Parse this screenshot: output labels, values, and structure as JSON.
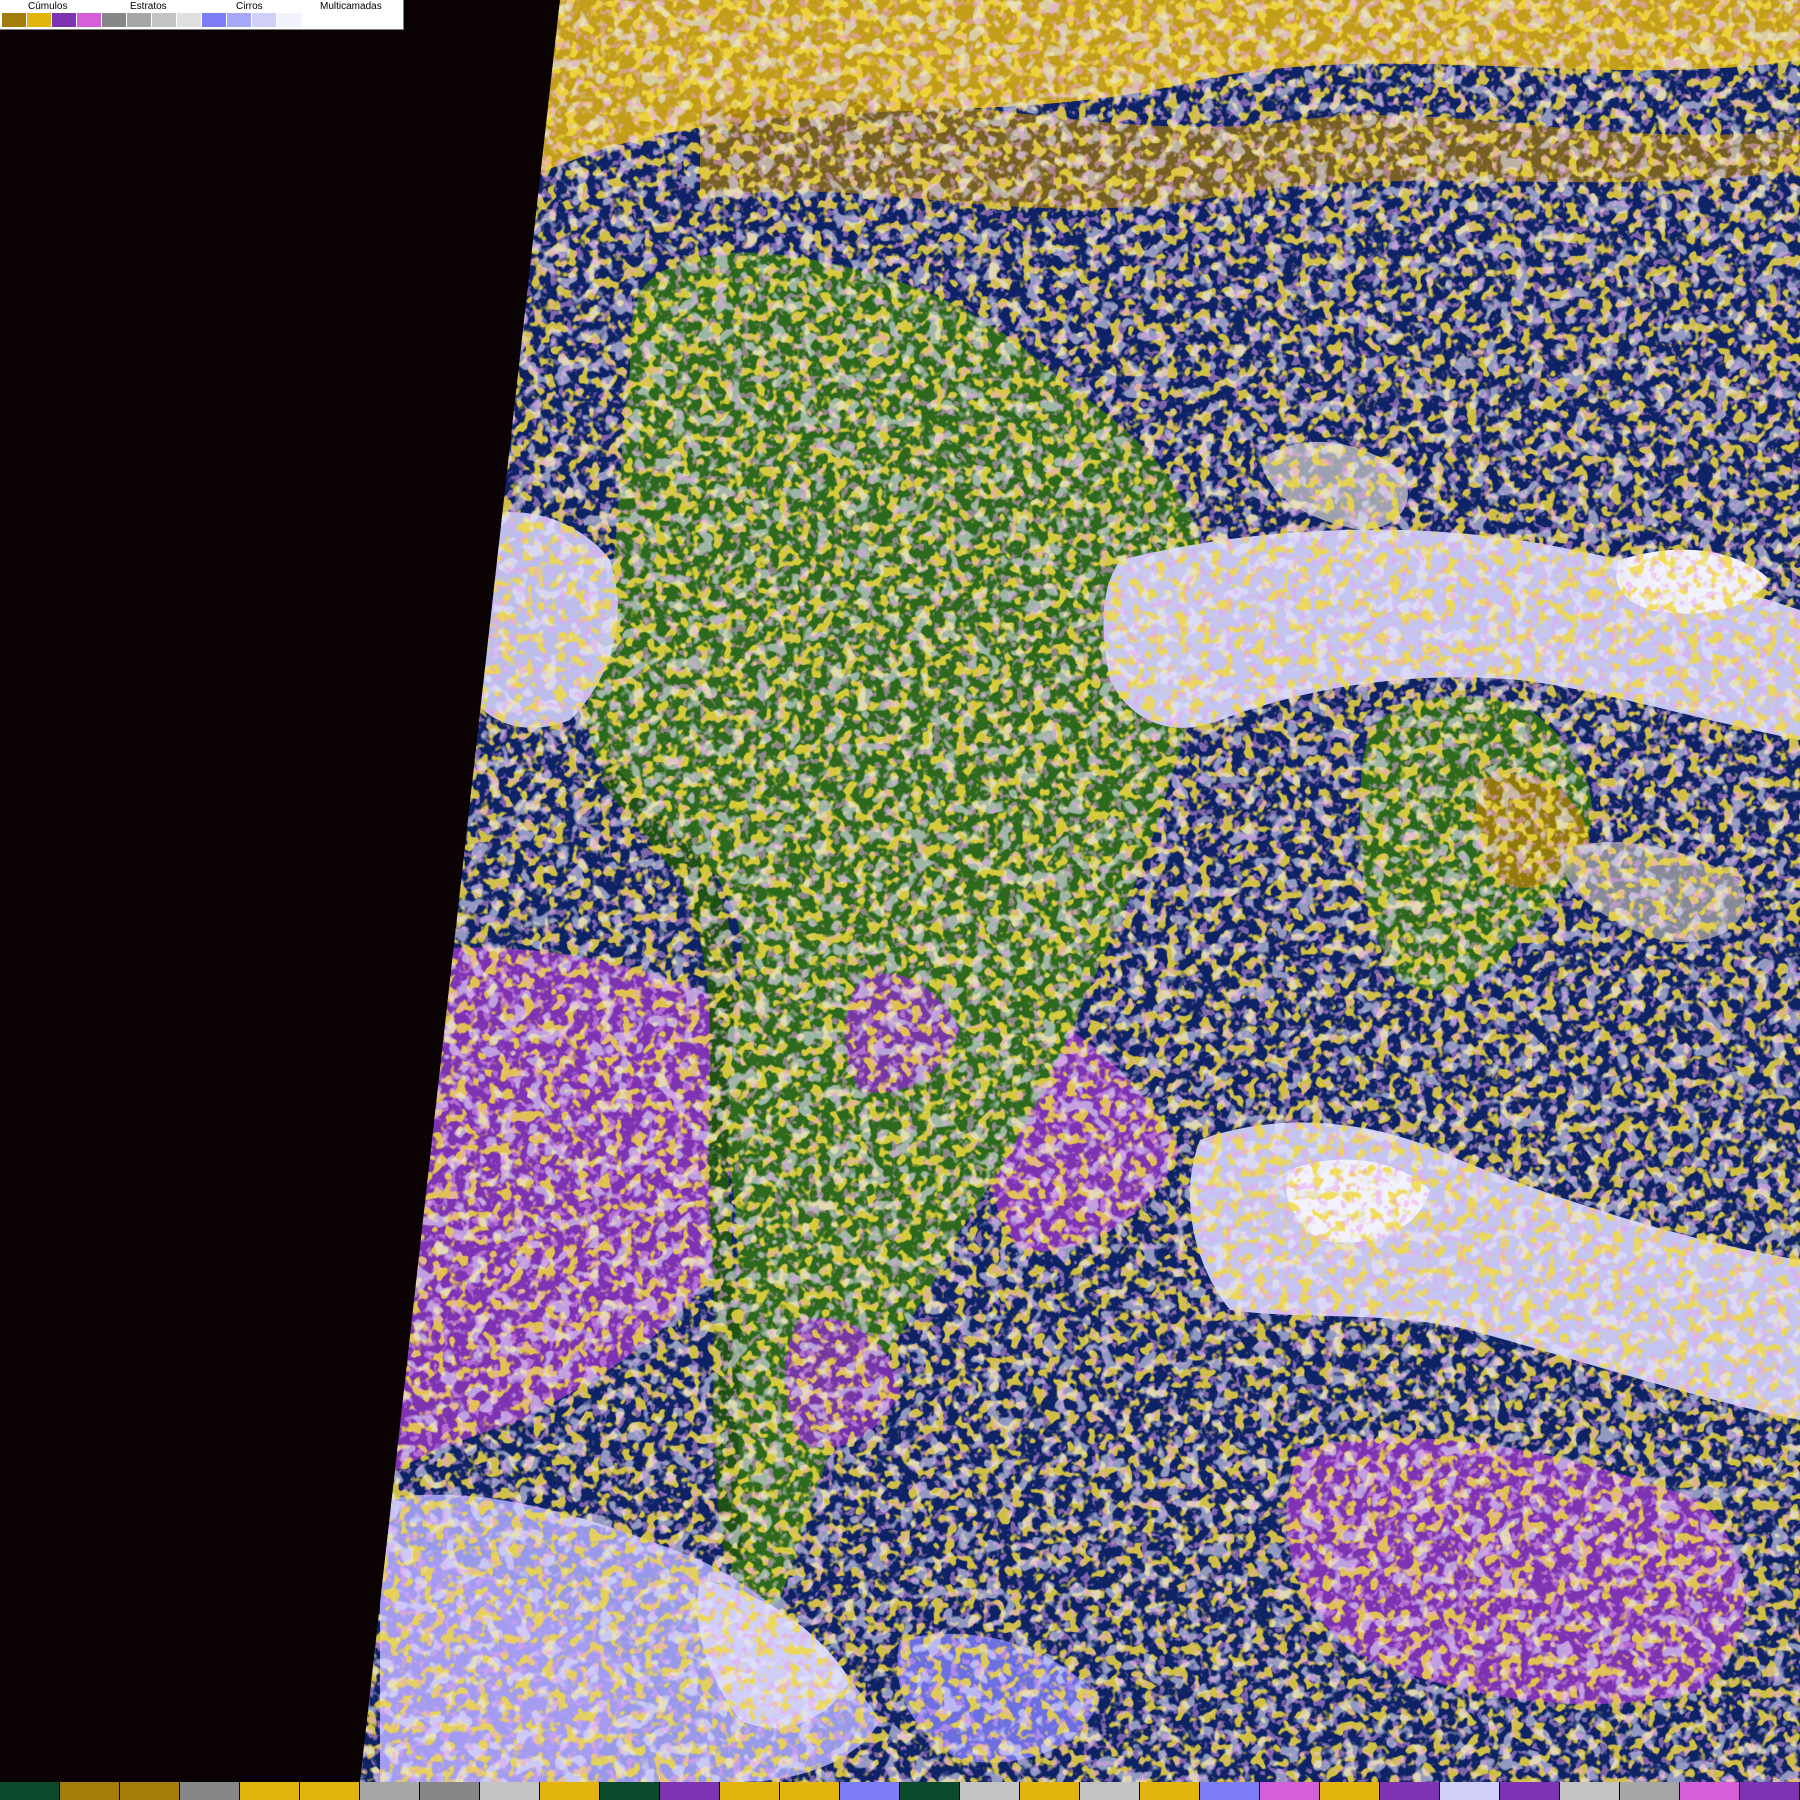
{
  "legend": {
    "categories": [
      {
        "label": "Cúmulos",
        "colors": [
          "#a47c0a",
          "#e3b40e"
        ]
      },
      {
        "label": "Estratos",
        "colors": [
          "#7e33b3",
          "#d65fd9"
        ]
      },
      {
        "label": "Cirros",
        "colors": [
          "#878787",
          "#a6a6a6",
          "#c3c3c3",
          "#e0e0e0"
        ]
      },
      {
        "label": "Multicamadas",
        "colors": [
          "#7c7cf5",
          "#a7a7f7",
          "#cfcff9",
          "#f2f2fd"
        ]
      }
    ]
  },
  "map": {
    "background_color": "#0a0203",
    "ocean_color": "#0e2266",
    "land_color": "#2e6a1e",
    "land_dark_color": "#1f5214",
    "stratus_color": "#7e33b3",
    "stratus_light_color": "#d65fd9",
    "cumulus_color": "#e3b40e",
    "cumulus_dark_color": "#a47c0a",
    "cirrus_color": "#c3c3c3",
    "multilayer_color": "#cfcff9",
    "multilayer_blue_color": "#7c7cf5",
    "multilayer_white_color": "#f2f2fd"
  },
  "bottom_strip": {
    "colors": [
      "#0b4a2a",
      "#a47c0a",
      "#a47c0a",
      "#878787",
      "#e3b40e",
      "#e3b40e",
      "#a6a6a6",
      "#878787",
      "#c3c3c3",
      "#e3b40e",
      "#0b4a2a",
      "#7e33b3",
      "#e3b40e",
      "#e3b40e",
      "#7c7cf5",
      "#0b4a2a",
      "#c3c3c3",
      "#e3b40e",
      "#c3c3c3",
      "#e3b40e",
      "#7c7cf5",
      "#d65fd9",
      "#e3b40e",
      "#7e33b3",
      "#cfcff9",
      "#7e33b3",
      "#c3c3c3",
      "#a6a6a6",
      "#d65fd9",
      "#7e33b3"
    ]
  }
}
